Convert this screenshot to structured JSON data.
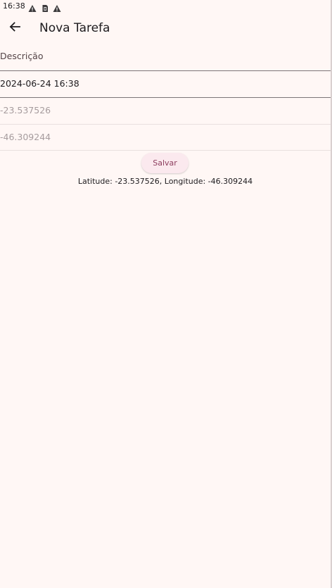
{
  "status_bar": {
    "time": "16:38",
    "icons": [
      "warning-icon",
      "sim-card-icon",
      "warning-icon"
    ]
  },
  "app_bar": {
    "back_icon": "arrow-back-icon",
    "title": "Nova Tarefa"
  },
  "form": {
    "description_label": "Descrição",
    "datetime_value": "2024-06-24 16:38",
    "latitude_placeholder": "-23.537526",
    "longitude_placeholder": "-46.309244",
    "save_label": "Salvar"
  },
  "location_text": "Latitude: -23.537526, Longitude: -46.309244",
  "colors": {
    "background": "#fff7f5",
    "button_bg": "#fbe9ee",
    "button_text": "#8d3d5e"
  }
}
